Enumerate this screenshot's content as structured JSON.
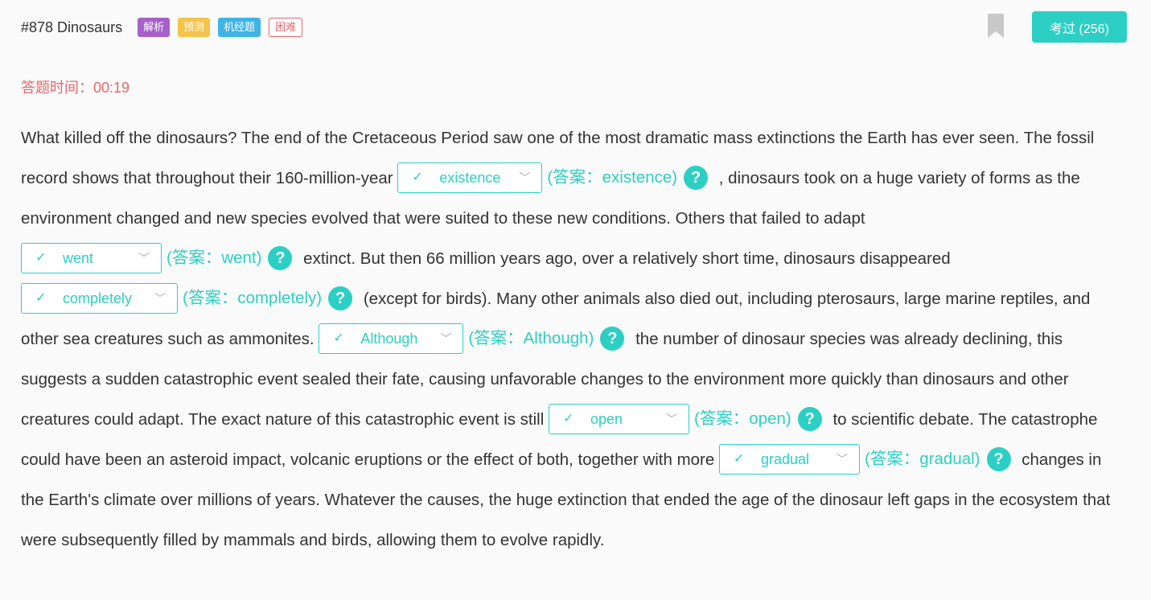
{
  "colors": {
    "accent": "#2ccfc3",
    "timer": "#e5676d",
    "tag_analysis": "#a760c9",
    "tag_predict": "#f5c44a",
    "tag_machine": "#3fb3e5",
    "tag_hard": "#e5676d",
    "bookmark": "#c8c8c8"
  },
  "header": {
    "title": "#878 Dinosaurs",
    "tags": [
      "解析",
      "预测",
      "机经题",
      "困难"
    ],
    "bookmark_icon": "bookmark-icon",
    "pass_button": "考过 (256)"
  },
  "timer": "答题时间：00:19",
  "passage": {
    "segments": [
      "What killed off the dinosaurs? The end of the Cretaceous Period saw one of the most dramatic mass extinctions the Earth has ever seen. The fossil record shows that throughout their 160-million-year ",
      " , dinosaurs took on a huge variety of forms as the environment changed and new species evolved that were suited to these new conditions. Others that failed to adapt ",
      " extinct. But then 66 million years ago, over a relatively short time, dinosaurs disappeared ",
      " (except for birds). Many other animals also died out, including pterosaurs, large marine reptiles, and other sea creatures such as ammonites. ",
      " the number of dinosaur species was already declining, this suggests a sudden catastrophic event sealed their fate, causing unfavorable changes to the environment more quickly than dinosaurs and other creatures could adapt. The exact nature of this catastrophic event is still ",
      " to scientific debate. The catastrophe could have been an asteroid impact, volcanic eruptions or the effect of both, together with more ",
      " changes in the Earth's climate over millions of years. Whatever the causes, the huge extinction that ended the age of the dinosaur left gaps in the ecosystem that were subsequently filled by mammals and birds, allowing them to evolve rapidly."
    ],
    "blanks": [
      {
        "selected": "existence",
        "answer": "(答案：existence)"
      },
      {
        "selected": "went",
        "answer": "(答案：went)"
      },
      {
        "selected": "completely",
        "answer": "(答案：completely)"
      },
      {
        "selected": "Although",
        "answer": "(答案：Although)"
      },
      {
        "selected": "open",
        "answer": "(答案：open)"
      },
      {
        "selected": "gradual",
        "answer": "(答案：gradual)"
      }
    ],
    "check_glyph": "✓",
    "chevron_glyph": "﹀",
    "help_glyph": "?"
  }
}
